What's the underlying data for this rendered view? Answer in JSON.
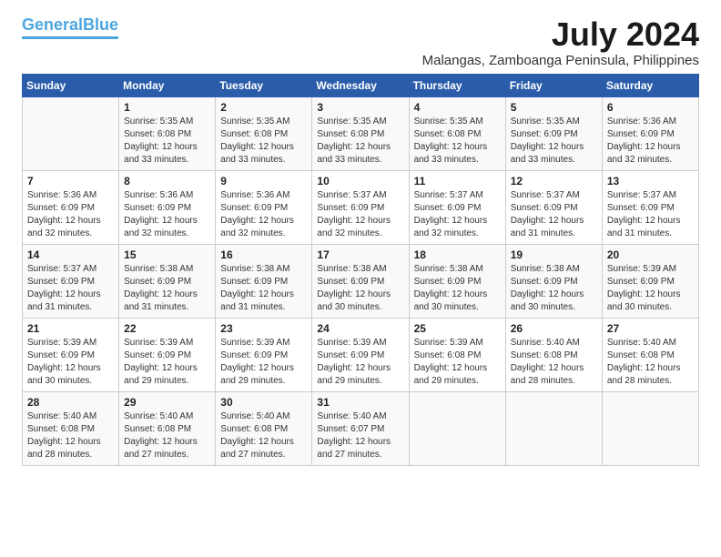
{
  "logo": {
    "line1": "General",
    "line2": "Blue"
  },
  "title": "July 2024",
  "location": "Malangas, Zamboanga Peninsula, Philippines",
  "days": [
    "Sunday",
    "Monday",
    "Tuesday",
    "Wednesday",
    "Thursday",
    "Friday",
    "Saturday"
  ],
  "weeks": [
    [
      {
        "num": "",
        "text": ""
      },
      {
        "num": "1",
        "text": "Sunrise: 5:35 AM\nSunset: 6:08 PM\nDaylight: 12 hours\nand 33 minutes."
      },
      {
        "num": "2",
        "text": "Sunrise: 5:35 AM\nSunset: 6:08 PM\nDaylight: 12 hours\nand 33 minutes."
      },
      {
        "num": "3",
        "text": "Sunrise: 5:35 AM\nSunset: 6:08 PM\nDaylight: 12 hours\nand 33 minutes."
      },
      {
        "num": "4",
        "text": "Sunrise: 5:35 AM\nSunset: 6:08 PM\nDaylight: 12 hours\nand 33 minutes."
      },
      {
        "num": "5",
        "text": "Sunrise: 5:35 AM\nSunset: 6:09 PM\nDaylight: 12 hours\nand 33 minutes."
      },
      {
        "num": "6",
        "text": "Sunrise: 5:36 AM\nSunset: 6:09 PM\nDaylight: 12 hours\nand 32 minutes."
      }
    ],
    [
      {
        "num": "7",
        "text": "Sunrise: 5:36 AM\nSunset: 6:09 PM\nDaylight: 12 hours\nand 32 minutes."
      },
      {
        "num": "8",
        "text": "Sunrise: 5:36 AM\nSunset: 6:09 PM\nDaylight: 12 hours\nand 32 minutes."
      },
      {
        "num": "9",
        "text": "Sunrise: 5:36 AM\nSunset: 6:09 PM\nDaylight: 12 hours\nand 32 minutes."
      },
      {
        "num": "10",
        "text": "Sunrise: 5:37 AM\nSunset: 6:09 PM\nDaylight: 12 hours\nand 32 minutes."
      },
      {
        "num": "11",
        "text": "Sunrise: 5:37 AM\nSunset: 6:09 PM\nDaylight: 12 hours\nand 32 minutes."
      },
      {
        "num": "12",
        "text": "Sunrise: 5:37 AM\nSunset: 6:09 PM\nDaylight: 12 hours\nand 31 minutes."
      },
      {
        "num": "13",
        "text": "Sunrise: 5:37 AM\nSunset: 6:09 PM\nDaylight: 12 hours\nand 31 minutes."
      }
    ],
    [
      {
        "num": "14",
        "text": "Sunrise: 5:37 AM\nSunset: 6:09 PM\nDaylight: 12 hours\nand 31 minutes."
      },
      {
        "num": "15",
        "text": "Sunrise: 5:38 AM\nSunset: 6:09 PM\nDaylight: 12 hours\nand 31 minutes."
      },
      {
        "num": "16",
        "text": "Sunrise: 5:38 AM\nSunset: 6:09 PM\nDaylight: 12 hours\nand 31 minutes."
      },
      {
        "num": "17",
        "text": "Sunrise: 5:38 AM\nSunset: 6:09 PM\nDaylight: 12 hours\nand 30 minutes."
      },
      {
        "num": "18",
        "text": "Sunrise: 5:38 AM\nSunset: 6:09 PM\nDaylight: 12 hours\nand 30 minutes."
      },
      {
        "num": "19",
        "text": "Sunrise: 5:38 AM\nSunset: 6:09 PM\nDaylight: 12 hours\nand 30 minutes."
      },
      {
        "num": "20",
        "text": "Sunrise: 5:39 AM\nSunset: 6:09 PM\nDaylight: 12 hours\nand 30 minutes."
      }
    ],
    [
      {
        "num": "21",
        "text": "Sunrise: 5:39 AM\nSunset: 6:09 PM\nDaylight: 12 hours\nand 30 minutes."
      },
      {
        "num": "22",
        "text": "Sunrise: 5:39 AM\nSunset: 6:09 PM\nDaylight: 12 hours\nand 29 minutes."
      },
      {
        "num": "23",
        "text": "Sunrise: 5:39 AM\nSunset: 6:09 PM\nDaylight: 12 hours\nand 29 minutes."
      },
      {
        "num": "24",
        "text": "Sunrise: 5:39 AM\nSunset: 6:09 PM\nDaylight: 12 hours\nand 29 minutes."
      },
      {
        "num": "25",
        "text": "Sunrise: 5:39 AM\nSunset: 6:08 PM\nDaylight: 12 hours\nand 29 minutes."
      },
      {
        "num": "26",
        "text": "Sunrise: 5:40 AM\nSunset: 6:08 PM\nDaylight: 12 hours\nand 28 minutes."
      },
      {
        "num": "27",
        "text": "Sunrise: 5:40 AM\nSunset: 6:08 PM\nDaylight: 12 hours\nand 28 minutes."
      }
    ],
    [
      {
        "num": "28",
        "text": "Sunrise: 5:40 AM\nSunset: 6:08 PM\nDaylight: 12 hours\nand 28 minutes."
      },
      {
        "num": "29",
        "text": "Sunrise: 5:40 AM\nSunset: 6:08 PM\nDaylight: 12 hours\nand 27 minutes."
      },
      {
        "num": "30",
        "text": "Sunrise: 5:40 AM\nSunset: 6:08 PM\nDaylight: 12 hours\nand 27 minutes."
      },
      {
        "num": "31",
        "text": "Sunrise: 5:40 AM\nSunset: 6:07 PM\nDaylight: 12 hours\nand 27 minutes."
      },
      {
        "num": "",
        "text": ""
      },
      {
        "num": "",
        "text": ""
      },
      {
        "num": "",
        "text": ""
      }
    ]
  ]
}
